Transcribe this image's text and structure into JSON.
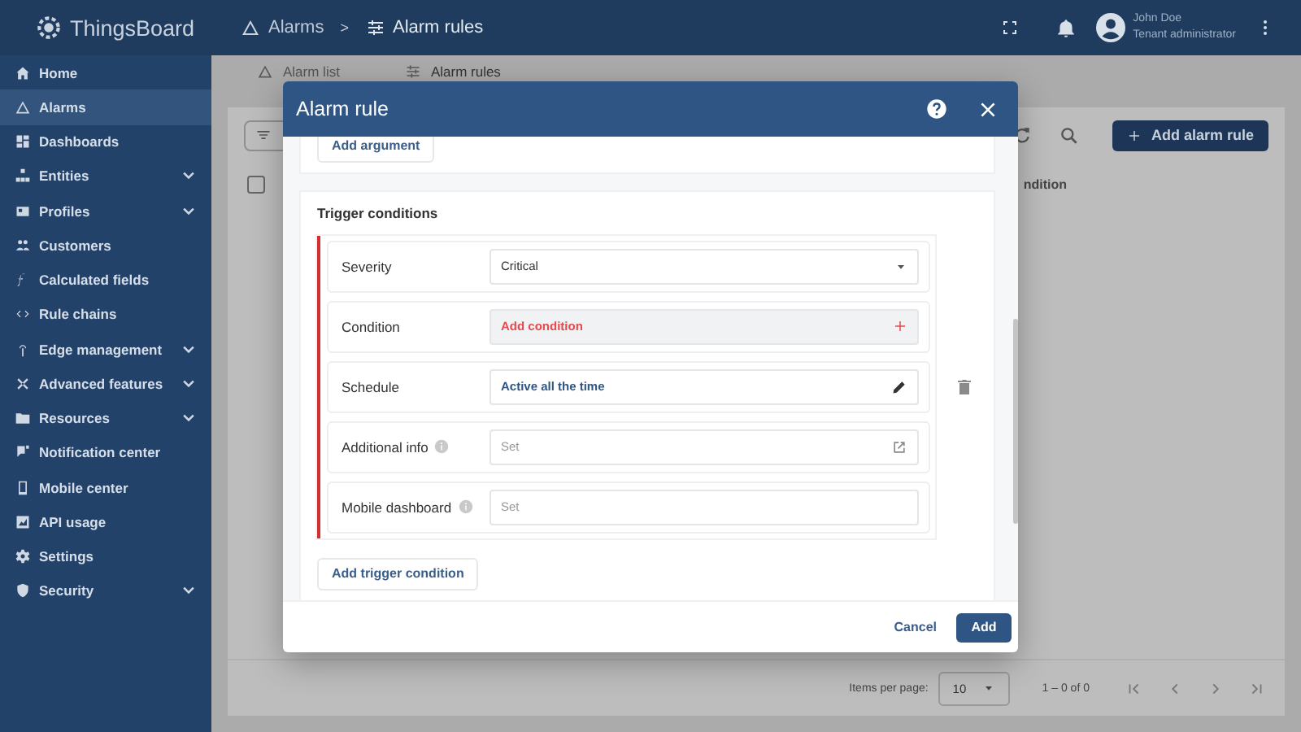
{
  "topbar": {
    "logo": "ThingsBoard",
    "breadcrumbs": [
      {
        "label": "Alarms"
      },
      {
        "label": "Alarm rules"
      }
    ],
    "separator": ">",
    "user": {
      "name": "John Doe",
      "role": "Tenant administrator"
    }
  },
  "sidebar": {
    "items": [
      {
        "label": "Home",
        "selected": false,
        "expandable": false
      },
      {
        "label": "Alarms",
        "selected": true,
        "expandable": false
      },
      {
        "label": "Dashboards",
        "selected": false,
        "expandable": false
      },
      {
        "label": "Entities",
        "selected": false,
        "expandable": true
      },
      {
        "label": "Profiles",
        "selected": false,
        "expandable": true
      },
      {
        "label": "Customers",
        "selected": false,
        "expandable": false
      },
      {
        "label": "Calculated fields",
        "selected": false,
        "expandable": false
      },
      {
        "label": "Rule chains",
        "selected": false,
        "expandable": false
      },
      {
        "label": "Edge management",
        "selected": false,
        "expandable": true
      },
      {
        "label": "Advanced features",
        "selected": false,
        "expandable": true
      },
      {
        "label": "Resources",
        "selected": false,
        "expandable": true
      },
      {
        "label": "Notification center",
        "selected": false,
        "expandable": false
      },
      {
        "label": "Mobile center",
        "selected": false,
        "expandable": false
      },
      {
        "label": "API usage",
        "selected": false,
        "expandable": false
      },
      {
        "label": "Settings",
        "selected": false,
        "expandable": false
      },
      {
        "label": "Security",
        "selected": false,
        "expandable": true
      }
    ]
  },
  "tabs": [
    {
      "label": "Alarm list",
      "selected": false
    },
    {
      "label": "Alarm rules",
      "selected": true
    }
  ],
  "toolbar": {
    "add_button": "Add alarm rule"
  },
  "table": {
    "select_all_checked": false,
    "columns": [
      {
        "label": "ndition"
      }
    ]
  },
  "pagination": {
    "items_per_page_label": "Items per page:",
    "page_size": "10",
    "range": "1 – 0 of 0"
  },
  "dialog": {
    "title": "Alarm rule",
    "add_argument": "Add argument",
    "section_title": "Trigger conditions",
    "conditions": [
      {
        "invalid": true,
        "rows": [
          {
            "kind": "select",
            "label": "Severity",
            "info": false,
            "value": "Critical"
          },
          {
            "kind": "add",
            "label": "Condition",
            "info": false,
            "value": "Add condition"
          },
          {
            "kind": "edit",
            "label": "Schedule",
            "info": false,
            "value": "Active all the time"
          },
          {
            "kind": "link",
            "label": "Additional info",
            "info": true,
            "placeholder": "Set"
          },
          {
            "kind": "text",
            "label": "Mobile dashboard",
            "info": true,
            "placeholder": "Set"
          }
        ]
      }
    ],
    "add_trigger": "Add trigger condition",
    "cancel": "Cancel",
    "submit": "Add"
  }
}
